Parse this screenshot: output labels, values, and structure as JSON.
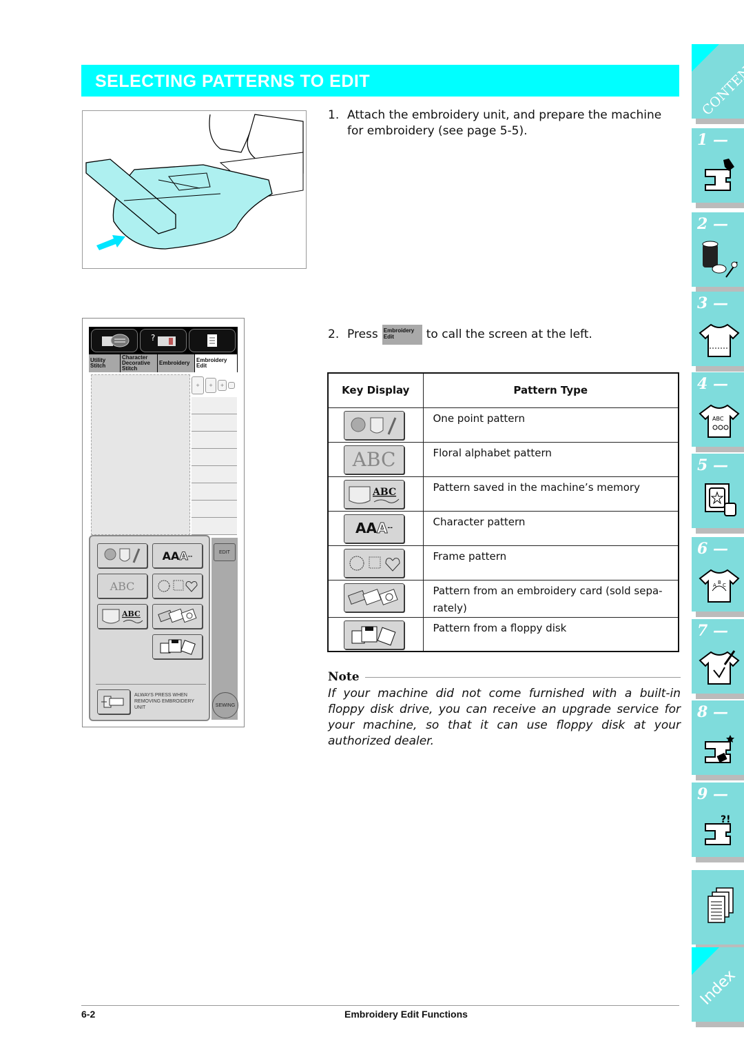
{
  "header": {
    "title": "SELECTING PATTERNS TO EDIT"
  },
  "steps": [
    {
      "number": "1.",
      "line1": "Attach the embroidery unit, and prepare the machine",
      "line2": "for embroidery (see page 5-5)."
    },
    {
      "number": "2.",
      "before": "Press",
      "key_line1": "Embroidery",
      "key_line2": "Edit",
      "after": "to call the screen at the left."
    }
  ],
  "lcd": {
    "tabs": [
      {
        "line1": "Utility",
        "line2": "Stitch",
        "line3": ""
      },
      {
        "line1": "Character",
        "line2": "Decorative",
        "line3": "Stitch"
      },
      {
        "line1": "Embroidery",
        "line2": "",
        "line3": ""
      },
      {
        "line1": "Embroidery",
        "line2": "Edit",
        "line3": ""
      }
    ],
    "keys": [
      "one-point",
      "AAA",
      "ABC",
      "frames",
      "ABC-memory",
      "card",
      "floppy"
    ],
    "edit_label": "EDIT",
    "sewing_label": "SEWING",
    "remove_text_1": "ALWAYS PRESS WHEN",
    "remove_text_2": "REMOVING EMBROIDERY",
    "remove_text_3": "UNIT"
  },
  "table": {
    "headers": {
      "key_display": "Key Display",
      "pattern_type": "Pattern Type"
    },
    "rows": [
      {
        "key": "one-point-key",
        "label": "One point pattern"
      },
      {
        "key": "floral-abc-key",
        "label": "Floral alphabet pattern"
      },
      {
        "key": "memory-key",
        "label": "Pattern saved in the machine’s memory"
      },
      {
        "key": "character-key",
        "label": "Character pattern"
      },
      {
        "key": "frame-key",
        "label": "Frame pattern"
      },
      {
        "key": "card-key",
        "label": "Pattern from an embroidery card (sold sepa-rately)"
      },
      {
        "key": "floppy-key",
        "label": "Pattern from a floppy disk"
      }
    ]
  },
  "note": {
    "label": "Note",
    "text": "If your machine did not come furnished with a built-in floppy disk drive, you can receive an upgrade service for your machine, so that it can use floppy disk at your authorized dealer."
  },
  "footer": {
    "page": "6-2",
    "title": "Embroidery Edit Functions"
  },
  "side_tabs": {
    "contents": "CONTENTS",
    "chapters": [
      "1 —",
      "2 —",
      "3 —",
      "4 —",
      "5 —",
      "6 —",
      "7 —",
      "8 —",
      "9 —"
    ],
    "index": "Index"
  },
  "colors": {
    "banner": "#00ffff",
    "tab": "#7fdcdc",
    "arrow": "#00e5ff"
  }
}
